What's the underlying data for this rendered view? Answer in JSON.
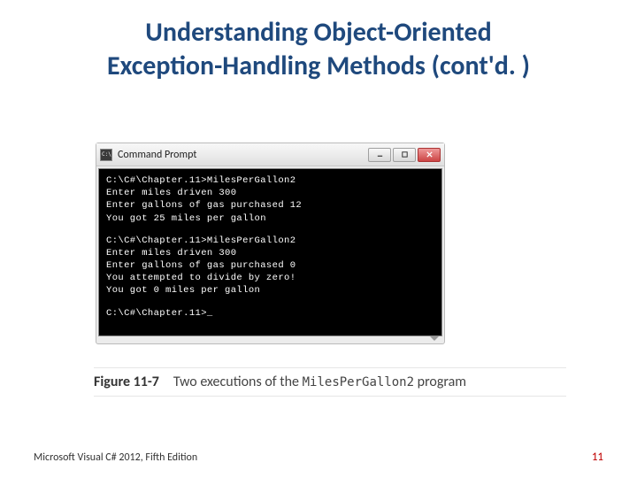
{
  "title_line1": "Understanding Object-Oriented",
  "title_line2": "Exception-Handling Methods (cont'd. )",
  "window": {
    "title": "Command Prompt",
    "lines_block1": [
      "C:\\C#\\Chapter.11>MilesPerGallon2",
      "Enter miles driven 300",
      "Enter gallons of gas purchased 12",
      "You got 25 miles per gallon"
    ],
    "lines_block2": [
      "C:\\C#\\Chapter.11>MilesPerGallon2",
      "Enter miles driven 300",
      "Enter gallons of gas purchased 0",
      "You attempted to divide by zero!",
      "You got 0 miles per gallon"
    ],
    "prompt_line": "C:\\C#\\Chapter.11>"
  },
  "figure": {
    "label": "Figure 11-7",
    "text_before": "Two executions of the ",
    "program_name": "MilesPerGallon2",
    "text_after": " program"
  },
  "footer": {
    "left": "Microsoft Visual C# 2012, Fifth Edition",
    "page": "11"
  }
}
